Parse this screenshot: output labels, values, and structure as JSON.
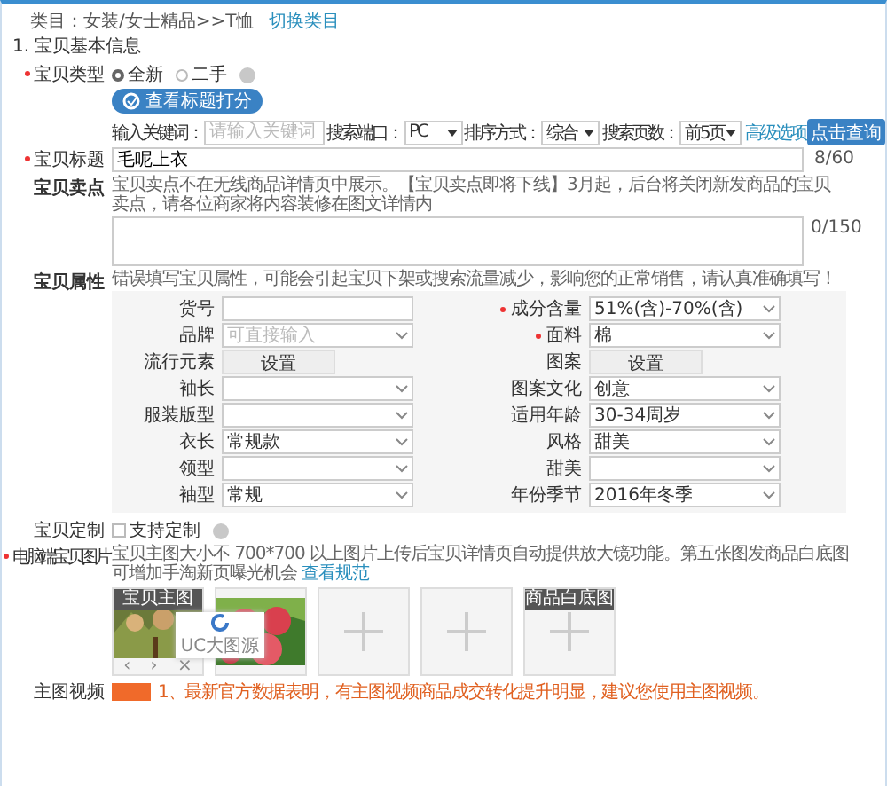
{
  "breadcrumb": {
    "text": "类目：女装/女士精品>>T恤",
    "link": "切换类目"
  },
  "section_title": "1. 宝贝基本信息",
  "item_type": {
    "label": "宝贝类型",
    "required": true,
    "options": [
      {
        "label": "全新",
        "selected": true
      },
      {
        "label": "二手",
        "selected": false
      }
    ]
  },
  "title_score_button": "查看标题打分",
  "keyword_search": {
    "fields": [
      {
        "kind": "input",
        "label": "输入关键词：",
        "placeholder": "请输入关键词"
      },
      {
        "kind": "select",
        "label": "搜索端口：",
        "value": "PC"
      },
      {
        "kind": "select",
        "label": "排序方式：",
        "value": "综合"
      },
      {
        "kind": "select",
        "label": "搜索页数：",
        "value": "前5页"
      }
    ],
    "advanced_link": "高级选项",
    "query_button": "点击查询"
  },
  "title_field": {
    "label": "宝贝标题",
    "required": true,
    "value": "毛呢上衣",
    "count": "8/60"
  },
  "selling_point": {
    "label": "宝贝卖点",
    "hint": "宝贝卖点不在无线商品详情页中展示。【宝贝卖点即将下线】3月起，后台将关闭新发商品的宝贝卖点，请各位商家将内容装修在图文详情内",
    "count": "0/150"
  },
  "attributes": {
    "label": "宝贝属性",
    "hint": "错误填写宝贝属性，可能会引起宝贝下架或搜索流量减少，影响您的正常销售，请认真准确填写！",
    "rows": [
      [
        {
          "label": "货号",
          "required": false,
          "kind": "input"
        },
        {
          "label": "成分含量",
          "required": true,
          "kind": "select",
          "value": "51%(含)-70%(含)"
        }
      ],
      [
        {
          "label": "品牌",
          "required": false,
          "kind": "select",
          "placeholder": "可直接输入"
        },
        {
          "label": "面料",
          "required": true,
          "kind": "select",
          "value": "棉"
        }
      ],
      [
        {
          "label": "流行元素",
          "required": false,
          "kind": "button",
          "value": "设置"
        },
        {
          "label": "图案",
          "required": false,
          "kind": "button",
          "value": "设置"
        }
      ],
      [
        {
          "label": "袖长",
          "required": false,
          "kind": "select"
        },
        {
          "label": "图案文化",
          "required": false,
          "kind": "select",
          "value": "创意"
        }
      ],
      [
        {
          "label": "服装版型",
          "required": false,
          "kind": "select"
        },
        {
          "label": "适用年龄",
          "required": false,
          "kind": "select",
          "value": "30-34周岁"
        }
      ],
      [
        {
          "label": "衣长",
          "required": false,
          "kind": "select",
          "value": "常规款"
        },
        {
          "label": "风格",
          "required": false,
          "kind": "select",
          "value": "甜美"
        }
      ],
      [
        {
          "label": "领型",
          "required": false,
          "kind": "select"
        },
        {
          "label": "甜美",
          "required": false,
          "kind": "select"
        }
      ],
      [
        {
          "label": "袖型",
          "required": false,
          "kind": "select",
          "value": "常规"
        },
        {
          "label": "年份季节",
          "required": false,
          "kind": "select",
          "value": "2016年冬季"
        }
      ]
    ]
  },
  "customization": {
    "label": "宝贝定制",
    "checkbox": {
      "label": "支持定制",
      "checked": false
    }
  },
  "images": {
    "label": "电脑端宝贝图片",
    "required": true,
    "hint_start": "宝贝主图大小不",
    "hint_rest": "700*700 以上图片上传后宝贝详情页自动提供放大镜功能。第五张图发商品白底图可增加手淘新页曝光机会",
    "link": "查看规范",
    "popup": "UC大图源",
    "slots": [
      {
        "kind": "picture",
        "caption": "宝贝主图",
        "controls": [
          "‹",
          "›",
          "×"
        ]
      },
      {
        "kind": "picture"
      },
      {
        "kind": "empty"
      },
      {
        "kind": "empty"
      },
      {
        "kind": "empty",
        "caption": "商品白底图"
      }
    ]
  },
  "video": {
    "label": "主图视频",
    "note": "1、最新官方数据表明，有主图视频商品成交转化提升明显，建议您使用主图视频。"
  }
}
